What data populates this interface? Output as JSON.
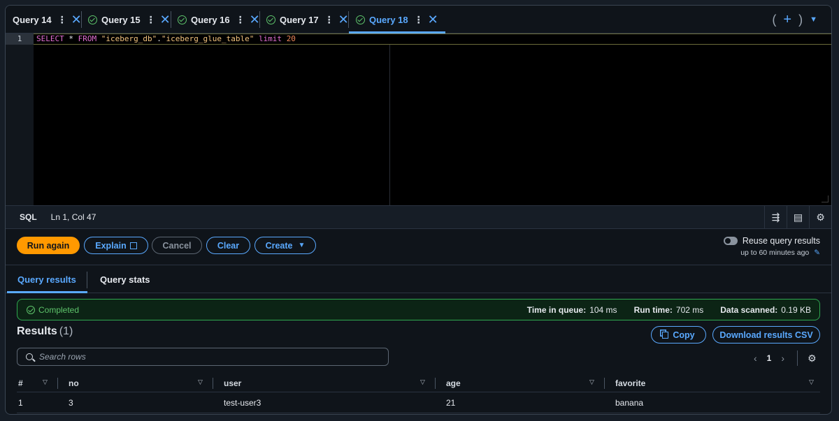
{
  "tabs": [
    {
      "label": "Query 14",
      "status": "none",
      "active": false
    },
    {
      "label": "Query 15",
      "status": "completed",
      "active": false
    },
    {
      "label": "Query 16",
      "status": "completed",
      "active": false
    },
    {
      "label": "Query 17",
      "status": "completed",
      "active": false
    },
    {
      "label": "Query 18",
      "status": "completed",
      "active": true
    }
  ],
  "editor": {
    "line_number": "1",
    "tokens": [
      "SELECT",
      " * ",
      "FROM",
      " ",
      "\"iceberg_db\"",
      ".",
      "\"iceberg_glue_table\"",
      " ",
      "limit",
      " ",
      "20"
    ]
  },
  "statusbar": {
    "language": "SQL",
    "cursor": "Ln 1, Col 47"
  },
  "actions": {
    "run_again": "Run again",
    "explain": "Explain",
    "cancel": "Cancel",
    "clear": "Clear",
    "create": "Create",
    "reuse_label": "Reuse query results",
    "reuse_sub": "up to 60 minutes ago"
  },
  "result_tabs": {
    "results": "Query results",
    "stats": "Query stats"
  },
  "banner": {
    "status": "Completed",
    "queue_label": "Time in queue:",
    "queue_value": "104 ms",
    "run_label": "Run time:",
    "run_value": "702 ms",
    "scanned_label": "Data scanned:",
    "scanned_value": "0.19 KB"
  },
  "results": {
    "title": "Results",
    "count": "(1)",
    "copy": "Copy",
    "download": "Download results CSV",
    "search_placeholder": "Search rows",
    "page": "1"
  },
  "table": {
    "columns": [
      "#",
      "no",
      "user",
      "age",
      "favorite"
    ],
    "rows": [
      [
        "1",
        "3",
        "test-user3",
        "21",
        "banana"
      ]
    ]
  },
  "colors": {
    "accent": "#5aa9ff",
    "primary": "#ff9900",
    "success": "#5ec46b"
  }
}
